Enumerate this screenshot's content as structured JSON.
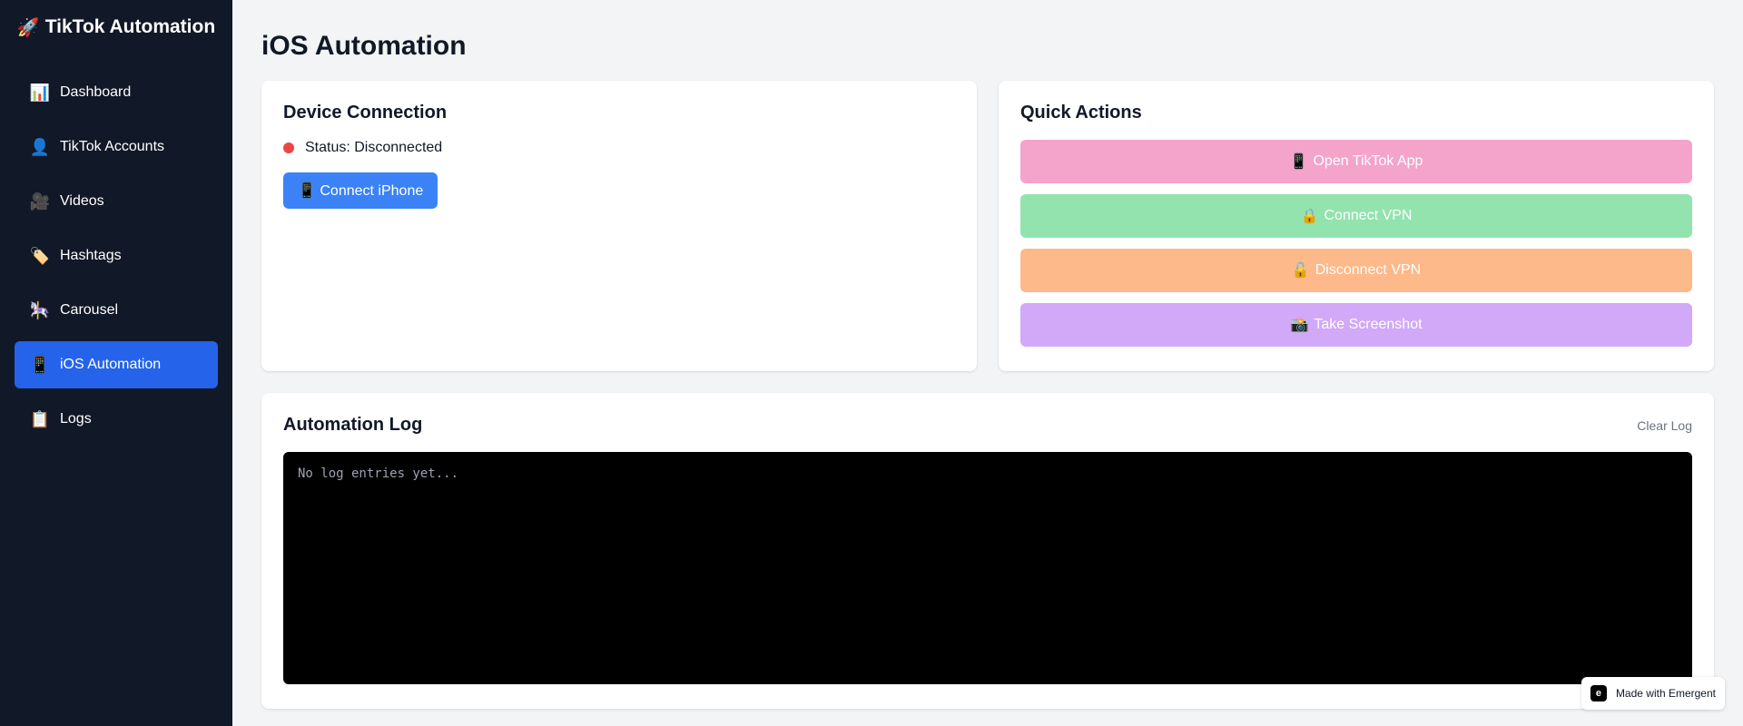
{
  "brand": {
    "icon": "🚀",
    "title": "TikTok Automation"
  },
  "sidebar": {
    "items": [
      {
        "icon": "📊",
        "label": "Dashboard",
        "active": false
      },
      {
        "icon": "👤",
        "label": "TikTok Accounts",
        "active": false
      },
      {
        "icon": "🎥",
        "label": "Videos",
        "active": false
      },
      {
        "icon": "🏷️",
        "label": "Hashtags",
        "active": false
      },
      {
        "icon": "🎠",
        "label": "Carousel",
        "active": false
      },
      {
        "icon": "📱",
        "label": "iOS Automation",
        "active": true
      },
      {
        "icon": "📋",
        "label": "Logs",
        "active": false
      }
    ]
  },
  "page": {
    "title": "iOS Automation"
  },
  "device": {
    "title": "Device Connection",
    "status": "Status: Disconnected",
    "status_color": "#ef4444",
    "connect_icon": "📱",
    "connect_label": "Connect iPhone"
  },
  "quick_actions": {
    "title": "Quick Actions",
    "buttons": [
      {
        "icon": "📱",
        "label": "Open TikTok App",
        "color": "#f4a3cb"
      },
      {
        "icon": "🔒",
        "label": "Connect VPN",
        "color": "#93e3ae"
      },
      {
        "icon": "🔓",
        "label": "Disconnect VPN",
        "color": "#fdb98a"
      },
      {
        "icon": "📸",
        "label": "Take Screenshot",
        "color": "#d2a8f8"
      }
    ]
  },
  "log": {
    "title": "Automation Log",
    "clear_label": "Clear Log",
    "empty_text": "No log entries yet..."
  },
  "badge": {
    "label": "Made with Emergent"
  },
  "colors": {
    "accent": "#2563eb",
    "sidebar_bg": "#111827",
    "page_bg": "#f3f4f6"
  }
}
